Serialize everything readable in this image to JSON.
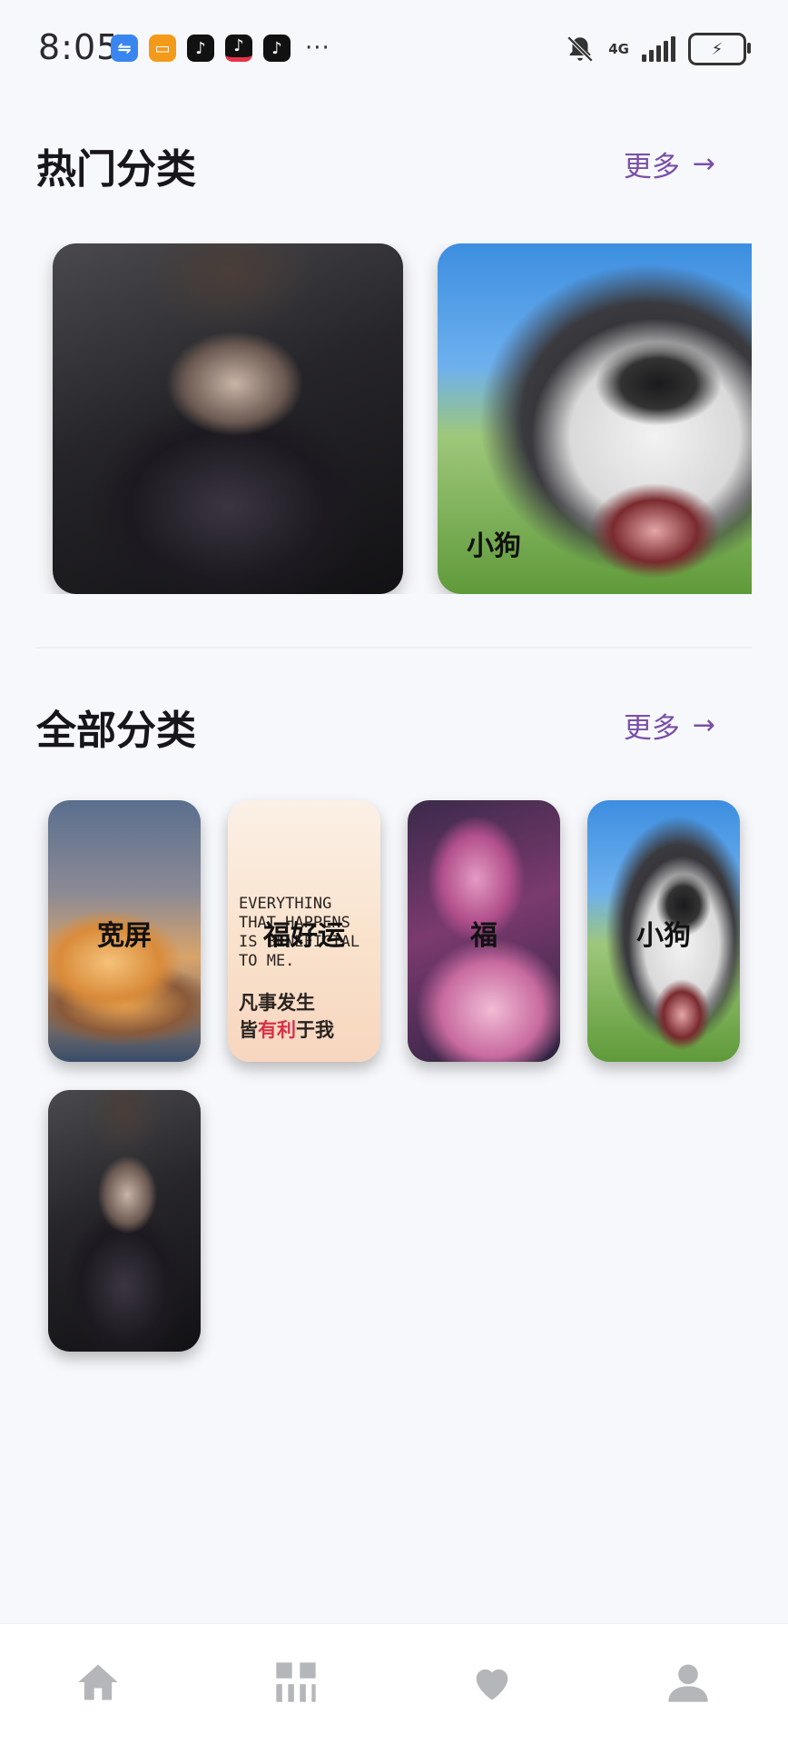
{
  "status_bar": {
    "time": "8:05",
    "network": "4G",
    "notifications": [
      "usb-icon",
      "game-icon",
      "tiktok-icon",
      "tiktok-icon",
      "tiktok-icon"
    ],
    "more": "···"
  },
  "hot_section": {
    "title": "热门分类",
    "more_label": "更多",
    "cards": [
      {
        "label": "",
        "image": "warrior-portrait"
      },
      {
        "label": "小狗",
        "image": "husky-dog"
      }
    ]
  },
  "all_section": {
    "title": "全部分类",
    "more_label": "更多",
    "cards": [
      {
        "label": "宽屏",
        "image": "clouds-landscape"
      },
      {
        "label": "福好运",
        "image": "fortune-text-art"
      },
      {
        "label": "福",
        "image": "pink-dragon"
      },
      {
        "label": "小狗",
        "image": "husky-dog"
      },
      {
        "label": "",
        "image": "warrior-portrait"
      }
    ],
    "fortune_art": {
      "en_text": "EVERYTHING THAT HAPPENS IS BENEFICIAL TO ME.",
      "cn_line1": "凡事发生",
      "cn_line2a": "皆",
      "cn_line2b": "有利",
      "cn_line2c": "于我"
    }
  },
  "bottom_nav": {
    "items": [
      "home-icon",
      "categories-icon",
      "favorites-icon",
      "profile-icon"
    ]
  },
  "colors": {
    "accent": "#7a4fa8",
    "background": "#f7f8fb",
    "nav_icon": "#b5b6ba"
  }
}
